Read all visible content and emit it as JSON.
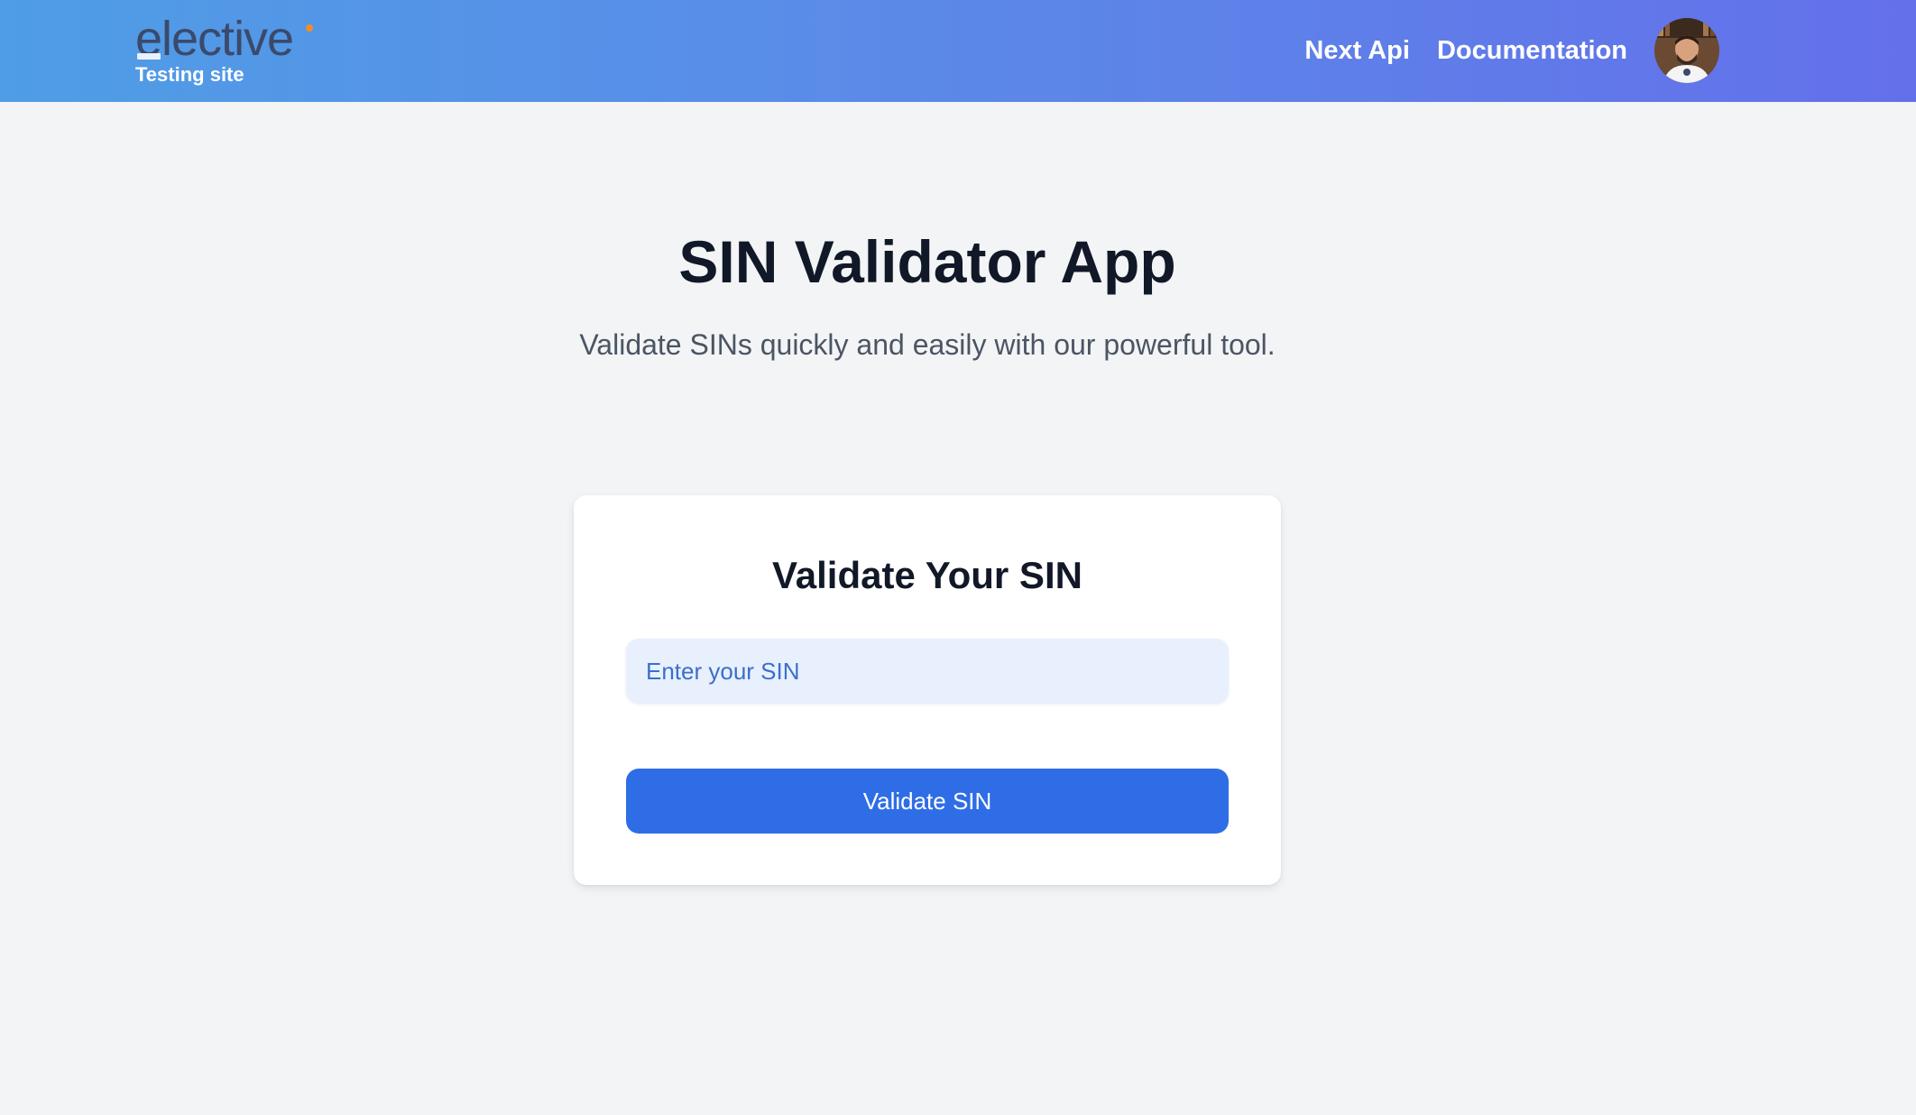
{
  "navbar": {
    "brand_name": "elective",
    "brand_subtitle": "Testing site",
    "links": [
      "Next Api",
      "Documentation"
    ],
    "avatar_icon": "user-avatar-photo"
  },
  "hero": {
    "title": "SIN Validator App",
    "subtitle": "Validate SINs quickly and easily with our powerful tool."
  },
  "card": {
    "title": "Validate Your SIN",
    "input_value": "",
    "input_placeholder": "Enter your SIN",
    "button_label": "Validate SIN"
  },
  "colors": {
    "navbar_gradient_start": "#4f9de6",
    "navbar_gradient_end": "#6470ea",
    "page_background": "#f3f4f6",
    "primary_button": "#2f6de6",
    "input_background": "#e8f0fe",
    "brand_text": "#3b4a6b"
  }
}
